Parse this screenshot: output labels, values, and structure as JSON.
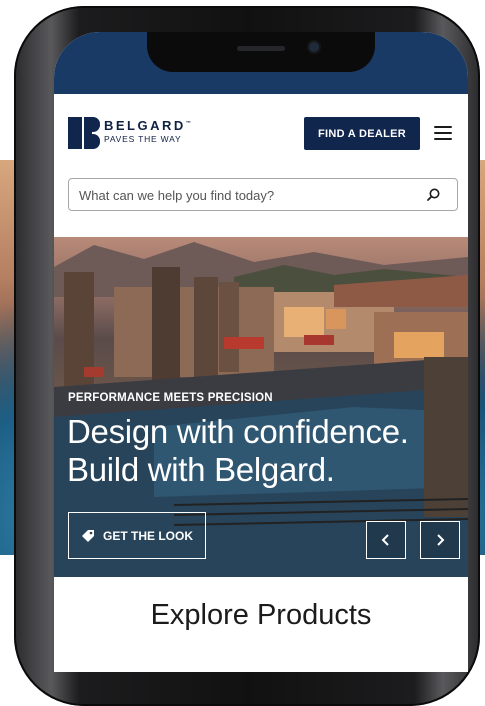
{
  "brand": {
    "name": "BELGARD",
    "tagline": "PAVES THE WAY",
    "trademark": "™",
    "color": "#10264d"
  },
  "header": {
    "find_dealer_label": "FIND A DEALER",
    "menu_icon": "hamburger-menu-icon"
  },
  "search": {
    "placeholder": "What can we help you find today?",
    "value": "",
    "icon": "search-icon"
  },
  "hero": {
    "eyebrow": "PERFORMANCE MEETS PRECISION",
    "headline_line1": "Design with confidence.",
    "headline_line2": "Build with Belgard.",
    "cta_label": "GET THE LOOK",
    "cta_icon": "tag-icon",
    "prev_icon": "chevron-left-icon",
    "next_icon": "chevron-right-icon"
  },
  "explore": {
    "title": "Explore Products"
  },
  "colors": {
    "status_bar": "#1a3a66",
    "button_navy": "#10264d",
    "text_dark": "#1b1b1b"
  }
}
